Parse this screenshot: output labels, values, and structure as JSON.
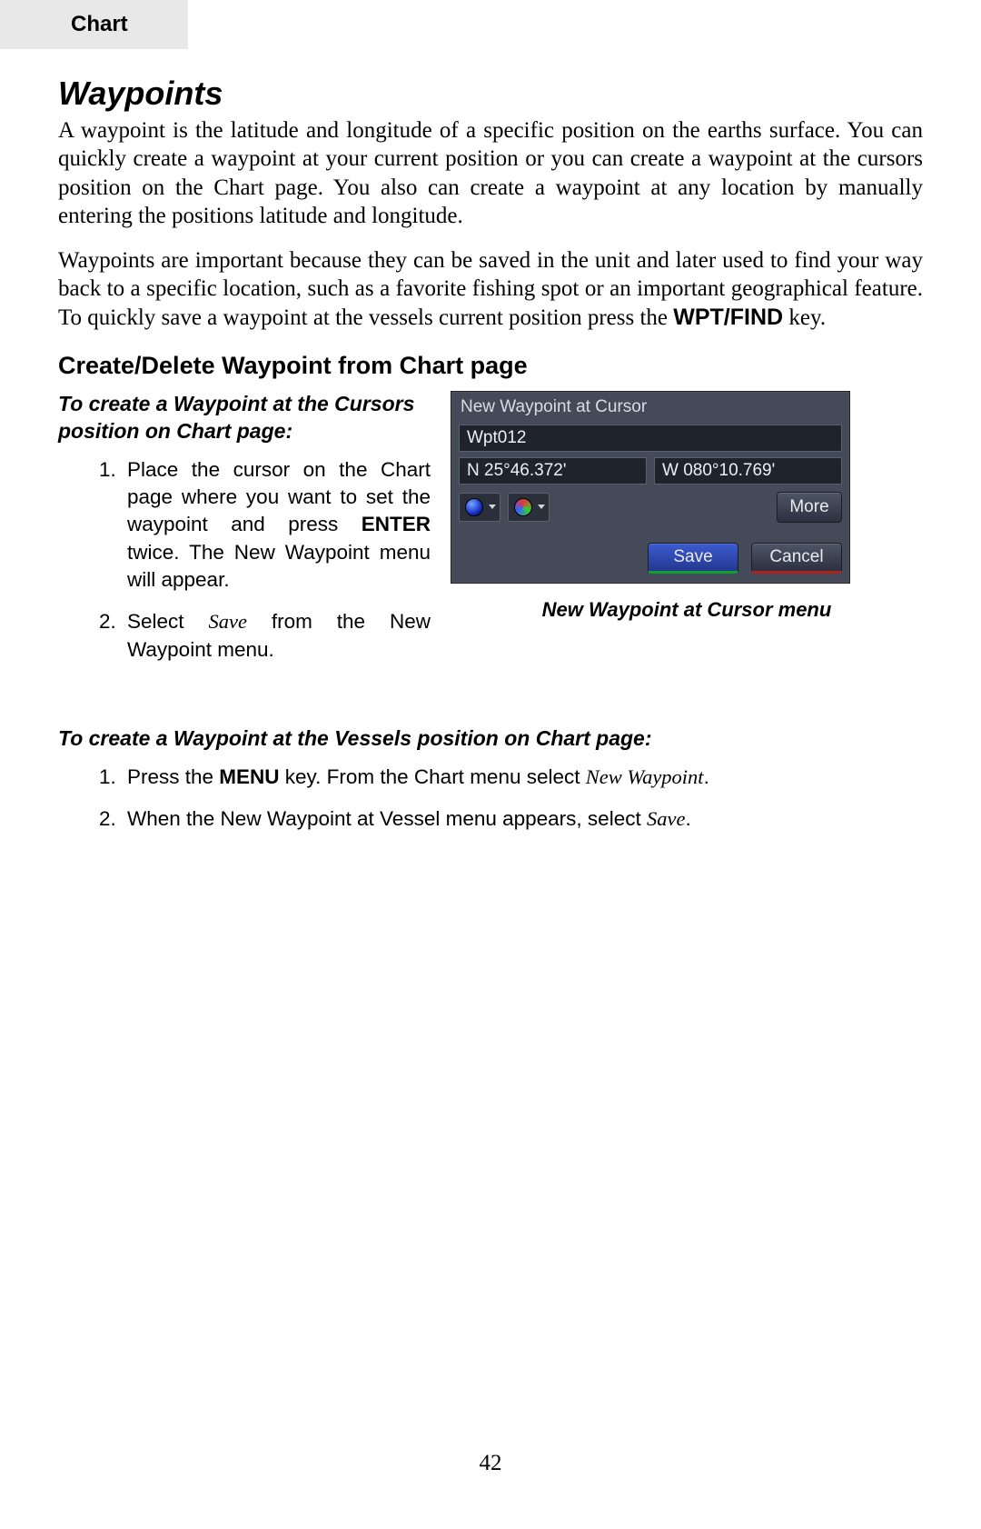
{
  "tab": {
    "label": "Chart"
  },
  "title": "Waypoints",
  "para1": "A waypoint is the latitude and longitude of a specific position on the earths surface. You can quickly create a waypoint at your current position or you can create a waypoint at the cursors position on the Chart page. You also can create a waypoint at any location by manually entering the positions latitude and longitude.",
  "para2_pre": "Waypoints are important because they can be saved in the unit and later used to find your way back to a specific location, such as a favorite fishing spot or an important geographical feature. To quickly save a waypoint at the vessels current position press the ",
  "para2_bold": "WPT/FIND",
  "para2_post": " key.",
  "subhead": "Create/Delete Waypoint from Chart page",
  "instrA_title": "To create a Waypoint at the Cursors position on Chart page:",
  "instrA_steps": {
    "s1_pre": "Place the cursor on the Chart page where you want to set the waypoint and press ",
    "s1_bold": "ENTER",
    "s1_post": " twice. The New Waypoint menu will appear.",
    "s2_pre": "Select ",
    "s2_ital": "Save",
    "s2_post": " from the New Waypoint menu."
  },
  "device": {
    "title": "New Waypoint at Cursor",
    "name": "Wpt012",
    "lat": "N 25°46.372'",
    "lon": "W 080°10.769'",
    "more": "More",
    "save": "Save",
    "cancel": "Cancel",
    "caption": "New Waypoint at Cursor menu"
  },
  "instrB_title": "To create a Waypoint at the Vessels position on Chart page:",
  "instrB_steps": {
    "s1_pre": "Press the ",
    "s1_bold": "MENU",
    "s1_mid": " key. From the Chart menu select ",
    "s1_ital": "New Waypoint",
    "s1_post": ".",
    "s2_pre": "When the New Waypoint at Vessel menu appears, select ",
    "s2_ital": "Save",
    "s2_post": "."
  },
  "page_number": "42"
}
